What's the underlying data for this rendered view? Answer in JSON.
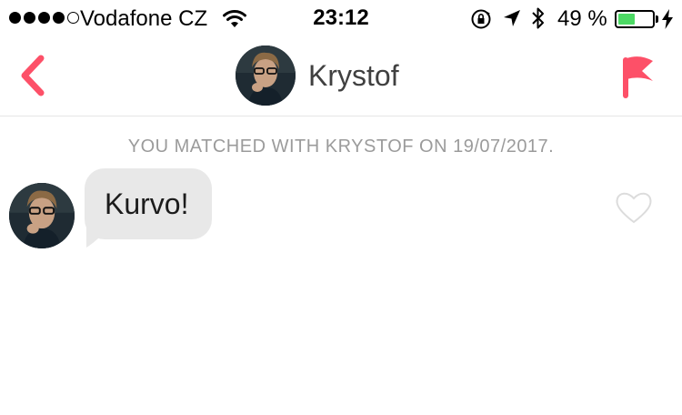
{
  "status_bar": {
    "signal_strength": 4,
    "signal_total": 5,
    "carrier": "Vodafone CZ",
    "time": "23:12",
    "battery_percent": "49 %",
    "battery_level": 0.49,
    "icons": [
      "wifi-icon",
      "rotation-lock-icon",
      "location-arrow-icon",
      "bluetooth-icon",
      "battery-icon",
      "charging-bolt-icon"
    ]
  },
  "nav": {
    "title": "Krystof",
    "back_icon": "chevron-left-icon",
    "report_icon": "flag-icon"
  },
  "conversation": {
    "match_notice": "YOU MATCHED WITH KRYSTOF ON 19/07/2017.",
    "messages": [
      {
        "text": "Kurvo!",
        "liked": false
      }
    ]
  },
  "colors": {
    "accent": "#fd5068",
    "bubble": "#e8e8e8",
    "notice_text": "#9b9b9b",
    "battery_fill": "#4cd964"
  }
}
